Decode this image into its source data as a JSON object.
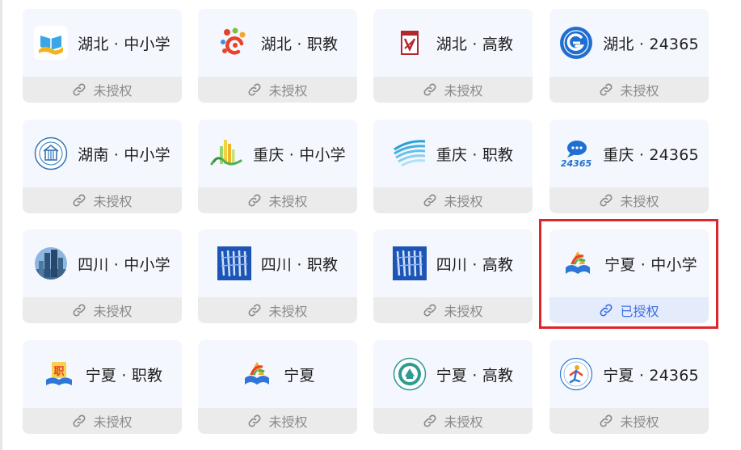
{
  "status_labels": {
    "unauthorized": "未授权",
    "authorized": "已授权"
  },
  "colors": {
    "card_bg": "#f4f7fe",
    "status_bg": "#ebebeb",
    "authorized_text": "#3b6fe6",
    "highlight_border": "#e0242b"
  },
  "cards": [
    {
      "name": "湖北 · 中小学",
      "logo": "hubei-k12-logo-icon",
      "authorized": false
    },
    {
      "name": "湖北 · 职教",
      "logo": "hubei-vocational-logo-icon",
      "authorized": false
    },
    {
      "name": "湖北 · 高教",
      "logo": "hubei-higher-ed-logo-icon",
      "authorized": false
    },
    {
      "name": "湖北 · 24365",
      "logo": "hubei-24365-logo-icon",
      "authorized": false
    },
    {
      "name": "湖南 · 中小学",
      "logo": "hunan-k12-logo-icon",
      "authorized": false
    },
    {
      "name": "重庆 · 中小学",
      "logo": "chongqing-k12-logo-icon",
      "authorized": false
    },
    {
      "name": "重庆 · 职教",
      "logo": "chongqing-vocational-logo-icon",
      "authorized": false
    },
    {
      "name": "重庆 · 24365",
      "logo": "chongqing-24365-logo-icon",
      "authorized": false
    },
    {
      "name": "四川 · 中小学",
      "logo": "sichuan-k12-logo-icon",
      "authorized": false
    },
    {
      "name": "四川 · 职教",
      "logo": "sichuan-vocational-logo-icon",
      "authorized": false
    },
    {
      "name": "四川 · 高教",
      "logo": "sichuan-higher-ed-logo-icon",
      "authorized": false
    },
    {
      "name": "宁夏 · 中小学",
      "logo": "ningxia-k12-logo-icon",
      "authorized": true
    },
    {
      "name": "宁夏 · 职教",
      "logo": "ningxia-vocational-logo-icon",
      "authorized": false
    },
    {
      "name": "宁夏",
      "logo": "ningxia-logo-icon",
      "authorized": false
    },
    {
      "name": "宁夏 · 高教",
      "logo": "ningxia-higher-ed-logo-icon",
      "authorized": false
    },
    {
      "name": "宁夏 · 24365",
      "logo": "ningxia-24365-logo-icon",
      "authorized": false
    }
  ]
}
